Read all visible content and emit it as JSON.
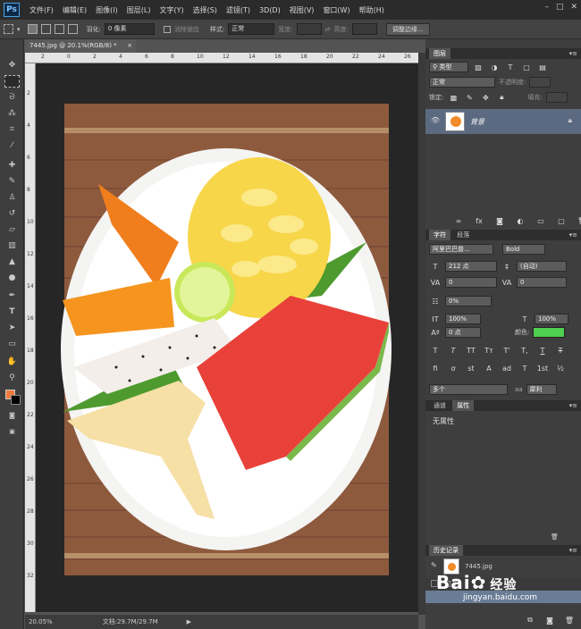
{
  "app": {
    "logo": "Ps"
  },
  "menubar": {
    "items": [
      "文件(F)",
      "编辑(E)",
      "图像(I)",
      "图层(L)",
      "文字(Y)",
      "选择(S)",
      "滤镜(T)",
      "3D(D)",
      "视图(V)",
      "窗口(W)",
      "帮助(H)"
    ],
    "window_controls": [
      "–",
      "□",
      "✕"
    ]
  },
  "options": {
    "feather_label": "羽化:",
    "feather_value": "0 像素",
    "antialias_label": "消除锯齿",
    "style_label": "样式:",
    "style_value": "正常",
    "width_label": "宽度:",
    "height_label": "高度:",
    "refine_button": "调整边缘..."
  },
  "document": {
    "tab_title": "7445.jpg @ 20.1%(RGB/8) *",
    "tab_close": "×",
    "ruler_top": [
      "2",
      "0",
      "2",
      "4",
      "6",
      "8",
      "10",
      "12",
      "14",
      "16",
      "18",
      "20",
      "22",
      "24",
      "26"
    ],
    "ruler_left": [
      "2",
      "4",
      "6",
      "8",
      "10",
      "12",
      "14",
      "16",
      "18",
      "20",
      "22",
      "24",
      "26",
      "28",
      "30",
      "32"
    ]
  },
  "status": {
    "zoom": "20.05%",
    "doc_size": "文档:29.7M/29.7M"
  },
  "tools": {
    "icons": [
      "move-tool-icon",
      "marquee-tool-icon",
      "lasso-tool-icon",
      "magic-wand-icon",
      "crop-tool-icon",
      "eyedropper-icon",
      "spot-heal-icon",
      "brush-tool-icon",
      "clone-stamp-icon",
      "history-brush-icon",
      "eraser-icon",
      "gradient-icon",
      "blur-icon",
      "dodge-icon",
      "pen-tool-icon",
      "type-tool-icon",
      "path-select-icon",
      "rectangle-tool-icon",
      "hand-tool-icon",
      "zoom-tool-icon"
    ],
    "foreground_color": "#f07a3c",
    "background_color": "#000000"
  },
  "layers": {
    "tab": "图层",
    "filter_label": "类型",
    "blend_mode": "正常",
    "opacity_label": "不透明度:",
    "lock_label": "锁定:",
    "fill_label": "填充:",
    "layer_name": "背景"
  },
  "character": {
    "tab_char": "字符",
    "tab_para": "段落",
    "font_family": "阿里巴巴普...",
    "font_style": "Bold",
    "font_size": "212 点",
    "leading": "(自动)",
    "kerning": "0",
    "tracking": "0",
    "scale_pct": "0%",
    "vscale": "100%",
    "hscale": "100%",
    "baseline": "0 点",
    "color_label": "颜色:",
    "color_value": "#4fd04f",
    "type_styles": [
      "T",
      "T",
      "TT",
      "Tт",
      "T'",
      "T,",
      "T",
      "T"
    ],
    "ot_styles": [
      "fi",
      "ơ",
      "st",
      "A",
      "ad",
      "T",
      "1st",
      "½"
    ],
    "language": "多个",
    "aa_mode": "犀利"
  },
  "properties": {
    "tab_channels": "通道",
    "tab_properties": "属性",
    "content": "无属性"
  },
  "history": {
    "tab": "历史记录",
    "snapshot": "7445.jpg",
    "step": "打开"
  },
  "watermark": {
    "brand": "Bai",
    "brand_tail": "经验",
    "site": "jingyan.baidu.com"
  }
}
